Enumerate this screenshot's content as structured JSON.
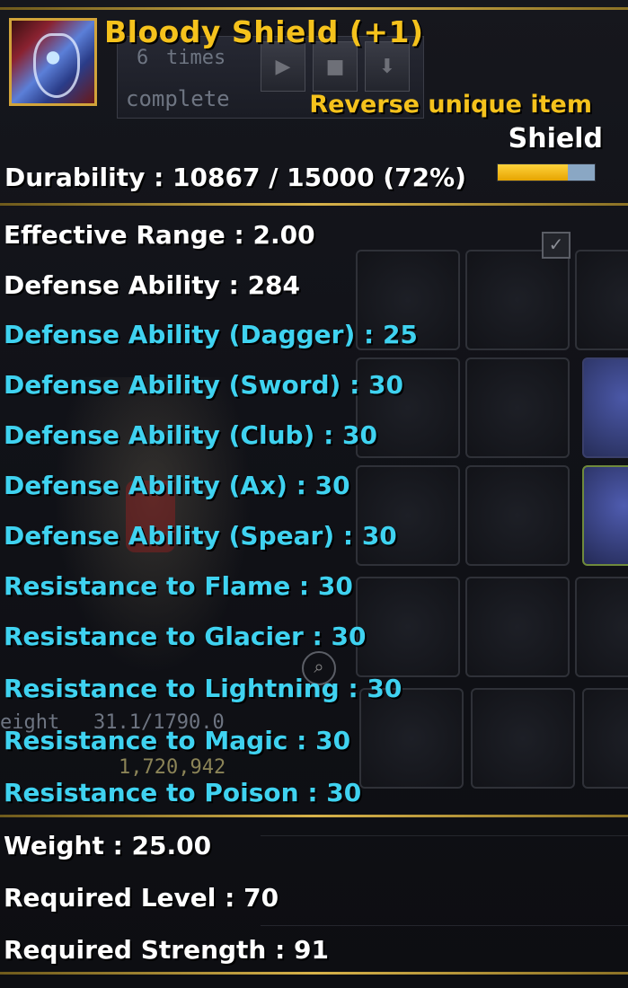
{
  "background": {
    "quest_count": "6",
    "quest_times": "times",
    "quest_status": "complete",
    "weight_label": "eight",
    "weight_value": "31.1/1790.0",
    "gold_value": "1,720,942",
    "buttons": [
      "play",
      "stop",
      "download"
    ]
  },
  "item": {
    "name": "Bloody Shield (+1)",
    "rarity": "Reverse unique item",
    "type": "Shield",
    "durability_text": "Durability : 10867 / 15000 (72%)",
    "durability_fraction": 0.72,
    "icon": "shield-item-icon"
  },
  "stats_main": [
    {
      "text": "Effective Range : 2.00",
      "color": "white"
    },
    {
      "text": "Defense Ability : 284",
      "color": "white"
    },
    {
      "text": "Defense Ability (Dagger) : 25",
      "color": "cyan"
    },
    {
      "text": "Defense Ability (Sword) : 30",
      "color": "cyan"
    },
    {
      "text": "Defense Ability (Club) : 30",
      "color": "cyan"
    },
    {
      "text": "Defense Ability (Ax) : 30",
      "color": "cyan"
    },
    {
      "text": "Defense Ability (Spear) : 30",
      "color": "cyan"
    },
    {
      "text": "Resistance to Flame : 30",
      "color": "cyan"
    },
    {
      "text": "Resistance to Glacier : 30",
      "color": "cyan"
    },
    {
      "text": "Resistance to Lightning : 30",
      "color": "cyan"
    },
    {
      "text": "Resistance to Magic : 30",
      "color": "cyan"
    },
    {
      "text": "Resistance to Poison : 30",
      "color": "cyan"
    }
  ],
  "stats_req": [
    {
      "text": "Weight : 25.00",
      "color": "white"
    },
    {
      "text": "Required Level : 70",
      "color": "white"
    },
    {
      "text": "Required Strength : 91",
      "color": "white"
    }
  ],
  "colors": {
    "title": "#f5c21c",
    "cyan_stat": "#3fd2f0",
    "white_stat": "#ffffff",
    "gold_border": "#d7b24a"
  }
}
